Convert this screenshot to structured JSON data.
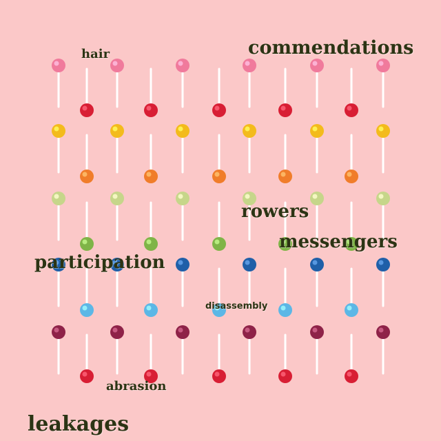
{
  "photo": {
    "background_color": "#fbc8c8",
    "stick_color": "#ffffff",
    "candy_rows": [
      {
        "color": "#f07a9c",
        "name": "pink"
      },
      {
        "color": "#d81e34",
        "name": "red"
      },
      {
        "color": "#f3bb1c",
        "name": "yellow"
      },
      {
        "color": "#f07d2a",
        "name": "orange"
      },
      {
        "color": "#c6d68a",
        "name": "pale-green"
      },
      {
        "color": "#7fb447",
        "name": "green"
      },
      {
        "color": "#1f5fa8",
        "name": "blue"
      },
      {
        "color": "#5cb7e6",
        "name": "light-blue"
      },
      {
        "color": "#8e2248",
        "name": "maroon"
      },
      {
        "color": "#d81e34",
        "name": "red"
      }
    ]
  },
  "words": {
    "commendations": "commendations",
    "hair": "hair",
    "rowers": "rowers",
    "messengers": "messengers",
    "participation": "participation",
    "disassembly": "disassembly",
    "abrasion": "abrasion",
    "leakages": "leakages"
  }
}
